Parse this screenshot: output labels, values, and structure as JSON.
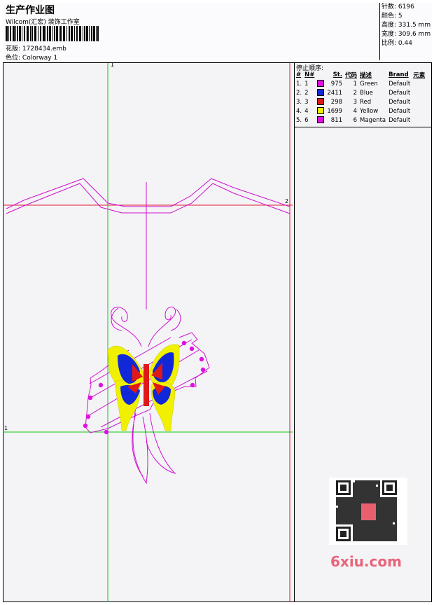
{
  "header": {
    "title": "生产作业图",
    "company": "Wilcom(汇宏) 装饰工作室",
    "design_label": "花版:",
    "design_value": "1728434.emb",
    "colorway_label": "色位:",
    "colorway_value": "Colorway 1"
  },
  "stats": [
    {
      "label": "针数:",
      "value": "6196"
    },
    {
      "label": "颜色:",
      "value": "5"
    },
    {
      "label": "高度:",
      "value": "331.5 mm"
    },
    {
      "label": "宽度:",
      "value": "309.6 mm"
    },
    {
      "label": "比例:",
      "value": "0.44"
    }
  ],
  "stop_sequence": {
    "title": "停止顺序:",
    "columns": [
      "#",
      "N#",
      "St.",
      "代码",
      "描述",
      "Brand",
      "元素"
    ],
    "rows": [
      {
        "num": "1.",
        "n": "1",
        "st": "975",
        "code": "1",
        "desc": "Green",
        "brand": "Default",
        "color": "#e010e0"
      },
      {
        "num": "2.",
        "n": "2",
        "st": "2411",
        "code": "2",
        "desc": "Blue",
        "brand": "Default",
        "color": "#1028d8"
      },
      {
        "num": "3.",
        "n": "3",
        "st": "298",
        "code": "3",
        "desc": "Red",
        "brand": "Default",
        "color": "#e01818"
      },
      {
        "num": "4.",
        "n": "4",
        "st": "1699",
        "code": "4",
        "desc": "Yellow",
        "brand": "Default",
        "color": "#f0f000"
      },
      {
        "num": "5.",
        "n": "6",
        "st": "811",
        "code": "6",
        "desc": "Magenta",
        "brand": "Default",
        "color": "#e010e0"
      }
    ]
  },
  "axis_labels": {
    "green_top": "1",
    "green_left": "1",
    "red_right": "2"
  },
  "watermark": "6xiu.com",
  "colors": {
    "green_guide": "#10c810",
    "red_guide": "#e01830",
    "outline": "#d010d0",
    "butterfly_blue": "#1028d8",
    "butterfly_yellow": "#f0f000",
    "butterfly_red": "#e01818"
  }
}
